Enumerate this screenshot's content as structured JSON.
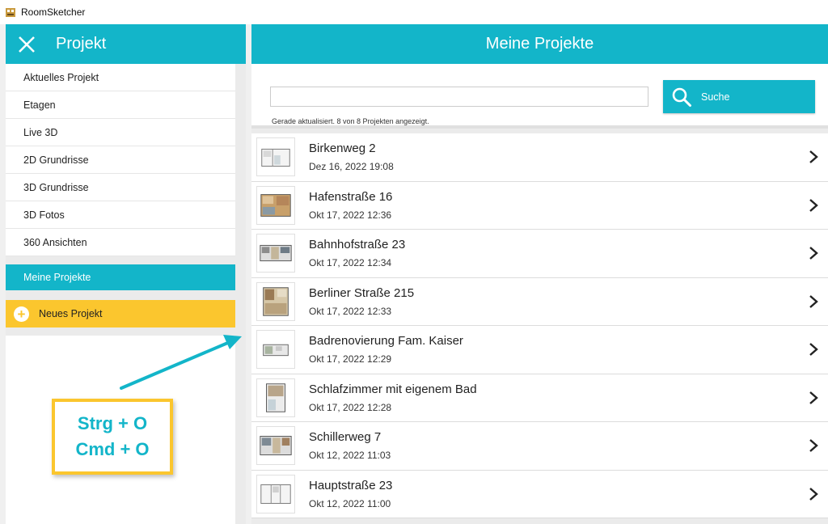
{
  "window": {
    "title": "RoomSketcher"
  },
  "sidebar": {
    "header_label": "Projekt",
    "items": [
      {
        "label": "Aktuelles Projekt"
      },
      {
        "label": "Etagen"
      },
      {
        "label": "Live 3D"
      },
      {
        "label": "2D Grundrisse"
      },
      {
        "label": "3D Grundrisse"
      },
      {
        "label": "3D Fotos"
      },
      {
        "label": "360 Ansichten"
      }
    ],
    "active_label": "Meine Projekte",
    "new_project_label": "Neues Projekt"
  },
  "main": {
    "header_title": "Meine Projekte",
    "search": {
      "value": "",
      "placeholder": "",
      "button_label": "Suche"
    },
    "status_text": "Gerade aktualisiert. 8 von 8 Projekten angezeigt.",
    "projects": [
      {
        "name": "Birkenweg 2",
        "date": "Dez 16, 2022 19:08"
      },
      {
        "name": "Hafenstraße 16",
        "date": "Okt 17, 2022 12:36"
      },
      {
        "name": "Bahnhofstraße 23",
        "date": "Okt 17, 2022 12:34"
      },
      {
        "name": "Berliner Straße 215",
        "date": "Okt 17, 2022 12:33"
      },
      {
        "name": "Badrenovierung Fam. Kaiser",
        "date": "Okt 17, 2022 12:29"
      },
      {
        "name": "Schlafzimmer mit eigenem Bad",
        "date": "Okt 17, 2022 12:28"
      },
      {
        "name": "Schillerweg 7",
        "date": "Okt 12, 2022 11:03"
      },
      {
        "name": "Hauptstraße 23",
        "date": "Okt 12, 2022 11:00"
      }
    ]
  },
  "annotation": {
    "line1": "Strg + O",
    "line2": "Cmd + O"
  },
  "colors": {
    "accent": "#13b5c9",
    "highlight": "#fbc62e",
    "background": "#ebebeb"
  }
}
